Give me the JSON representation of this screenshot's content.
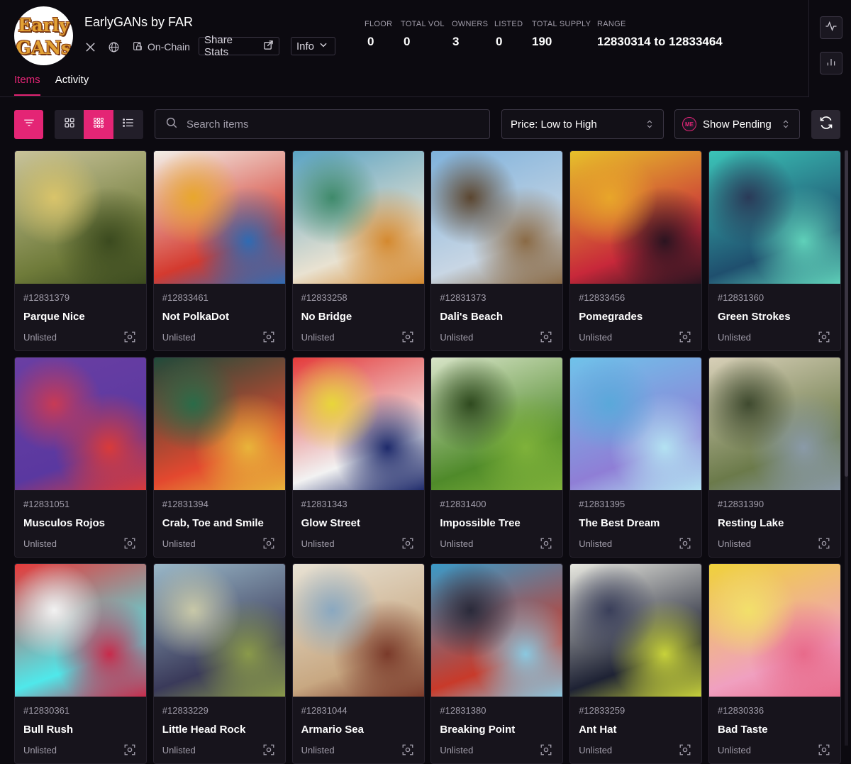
{
  "collection": {
    "logo_text_line1": "Early",
    "logo_text_line2": "GANs",
    "title": "EarlyGANs by FAR",
    "onchain_label": "On-Chain",
    "share_label": "Share Stats",
    "info_label": "Info"
  },
  "stats": [
    {
      "label": "FLOOR",
      "value": "0"
    },
    {
      "label": "TOTAL VOL",
      "value": "0"
    },
    {
      "label": "OWNERS",
      "value": "3"
    },
    {
      "label": "LISTED",
      "value": "0"
    },
    {
      "label": "TOTAL SUPPLY",
      "value": "190"
    },
    {
      "label": "RANGE",
      "value": "12830314 to 12833464"
    }
  ],
  "tabs": [
    {
      "label": "Items",
      "active": true
    },
    {
      "label": "Activity",
      "active": false
    }
  ],
  "toolbar": {
    "search_placeholder": "Search items",
    "sort_value": "Price: Low to High",
    "pending_value": "Show Pending",
    "me_badge": "ME"
  },
  "colors": {
    "accent": "#e42575",
    "background": "#0c0a10",
    "card": "#17141c"
  },
  "icons": [
    "x-icon",
    "globe-icon",
    "lock-icon",
    "share-icon",
    "chevron-down-icon",
    "pulse-icon",
    "bar-chart-icon",
    "filter-icon",
    "grid-large-icon",
    "grid-small-icon",
    "list-icon",
    "search-icon",
    "chevron-updown-icon",
    "refresh-icon",
    "scan-icon"
  ],
  "items": [
    {
      "id": "#12831379",
      "name": "Parque Nice",
      "status": "Unlisted",
      "colors": [
        "#c9c39a",
        "#6f7b3a",
        "#3b4a1f",
        "#d9c46a"
      ]
    },
    {
      "id": "#12833461",
      "name": "Not PolkaDot",
      "status": "Unlisted",
      "colors": [
        "#f3efe8",
        "#d43a2f",
        "#2f6bb3",
        "#e8a72d"
      ]
    },
    {
      "id": "#12833258",
      "name": "No Bridge",
      "status": "Unlisted",
      "colors": [
        "#5aa3c4",
        "#e9e2d1",
        "#d4892f",
        "#3f8a6b"
      ]
    },
    {
      "id": "#12831373",
      "name": "Dali's Beach",
      "status": "Unlisted",
      "colors": [
        "#7fb2dc",
        "#c8d6e4",
        "#8a6a45",
        "#5b4630"
      ]
    },
    {
      "id": "#12833456",
      "name": "Pomegrades",
      "status": "Unlisted",
      "colors": [
        "#e7c12a",
        "#c8283a",
        "#2a1420",
        "#e8a62a"
      ]
    },
    {
      "id": "#12831360",
      "name": "Green Strokes",
      "status": "Unlisted",
      "colors": [
        "#3bc4b8",
        "#1f4f6e",
        "#5fd1b9",
        "#2a3a58"
      ]
    },
    {
      "id": "#12831051",
      "name": "Musculos Rojos",
      "status": "Unlisted",
      "colors": [
        "#6a3fa3",
        "#5a38a0",
        "#d93a3a",
        "#c83a55"
      ]
    },
    {
      "id": "#12831394",
      "name": "Crab, Toe and Smile",
      "status": "Unlisted",
      "colors": [
        "#1f4a3a",
        "#e3482f",
        "#e8b43a",
        "#2a6b48"
      ]
    },
    {
      "id": "#12831343",
      "name": "Glow Street",
      "status": "Unlisted",
      "colors": [
        "#e43a3a",
        "#f2f2f2",
        "#1e2a6b",
        "#e8d63a"
      ]
    },
    {
      "id": "#12831400",
      "name": "Impossible Tree",
      "status": "Unlisted",
      "colors": [
        "#d8e4c8",
        "#4f8a2a",
        "#7fb23a",
        "#2f4a1f"
      ]
    },
    {
      "id": "#12831395",
      "name": "The Best Dream",
      "status": "Unlisted",
      "colors": [
        "#6fc3ea",
        "#8f7ed6",
        "#b3e2f2",
        "#5aa8da"
      ]
    },
    {
      "id": "#12831390",
      "name": "Resting Lake",
      "status": "Unlisted",
      "colors": [
        "#d8d0b8",
        "#6b7a4a",
        "#8a9aa8",
        "#3f4a2f"
      ]
    },
    {
      "id": "#12830361",
      "name": "Bull Rush",
      "status": "Unlisted",
      "colors": [
        "#e63a3a",
        "#4fe8ea",
        "#c82a4a",
        "#f2f2f2"
      ]
    },
    {
      "id": "#12833229",
      "name": "Little Head Rock",
      "status": "Unlisted",
      "colors": [
        "#9ab8c8",
        "#3a3a5a",
        "#8a9a4a",
        "#c8c8a8"
      ]
    },
    {
      "id": "#12831044",
      "name": "Armario Sea",
      "status": "Unlisted",
      "colors": [
        "#e8e2d4",
        "#c8a882",
        "#7a3a2a",
        "#8aa8c0"
      ]
    },
    {
      "id": "#12831380",
      "name": "Breaking Point",
      "status": "Unlisted",
      "colors": [
        "#3a9ac8",
        "#c83a2a",
        "#8ac8e0",
        "#2a2a3a"
      ]
    },
    {
      "id": "#12833259",
      "name": "Ant Hat",
      "status": "Unlisted",
      "colors": [
        "#e8e8e0",
        "#1e2234",
        "#c8d23a",
        "#3a3f5a"
      ]
    },
    {
      "id": "#12830336",
      "name": "Bad Taste",
      "status": "Unlisted",
      "colors": [
        "#f0d23a",
        "#f0a0c0",
        "#e86a8a",
        "#f2e06a"
      ]
    }
  ]
}
